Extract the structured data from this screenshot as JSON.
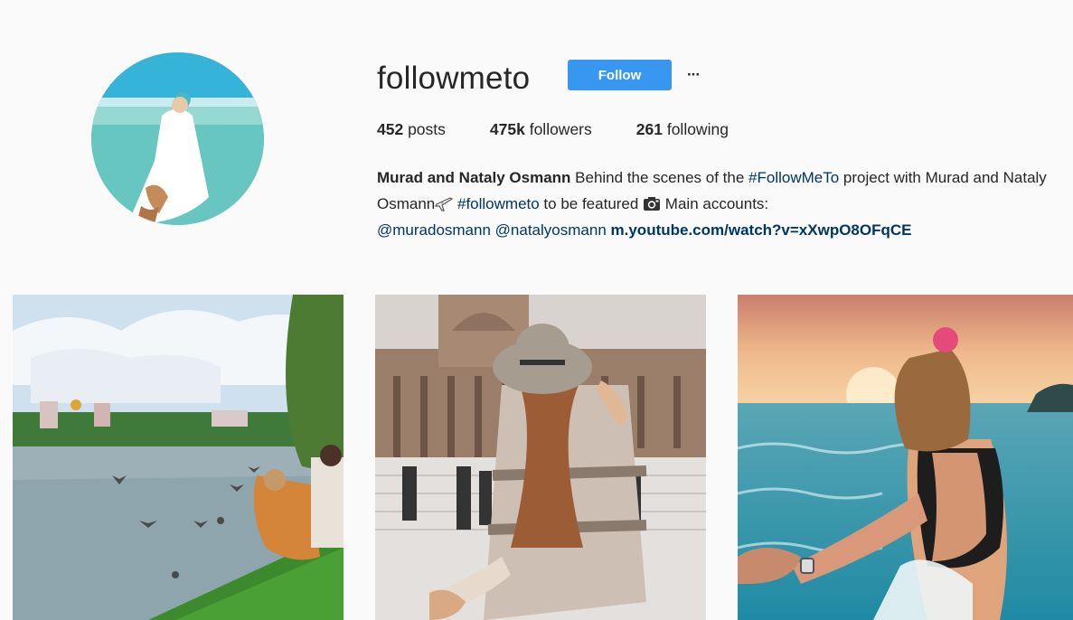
{
  "profile": {
    "username": "followmeto",
    "follow_label": "Follow",
    "more_label": "···",
    "stats": {
      "posts_count": "452",
      "posts_label": " posts",
      "followers_count": "475k",
      "followers_label": " followers",
      "following_count": "261",
      "following_label": " following"
    },
    "bio": {
      "full_name": "Murad and Nataly Osmann",
      "text_1": " Behind the scenes of the ",
      "hashtag_1": "#FollowMeTo",
      "text_2": " project with Murad and Nataly Osmann",
      "text_3": " ",
      "hashtag_2": "#followmeto",
      "text_4": " to be featured ",
      "text_5": " Main accounts:",
      "mention_1": "@muradosmann",
      "mention_2": "@natalyosmann",
      "link": "m.youtube.com/watch?v=xXwpO8OFqCE"
    },
    "icons": {
      "bio_emoji_1": "airplane-icon",
      "bio_emoji_2": "camera-icon",
      "more": "ellipsis-icon"
    }
  },
  "colors": {
    "follow_button": "#3897f0",
    "link_text": "#003569",
    "background": "#fafafa"
  },
  "posts": [
    {
      "subject": "lake with pigeons and couple on grass"
    },
    {
      "subject": "woman in hat leading by the hand in Paris"
    },
    {
      "subject": "woman in swimsuit leading into the sea at sunset"
    }
  ]
}
